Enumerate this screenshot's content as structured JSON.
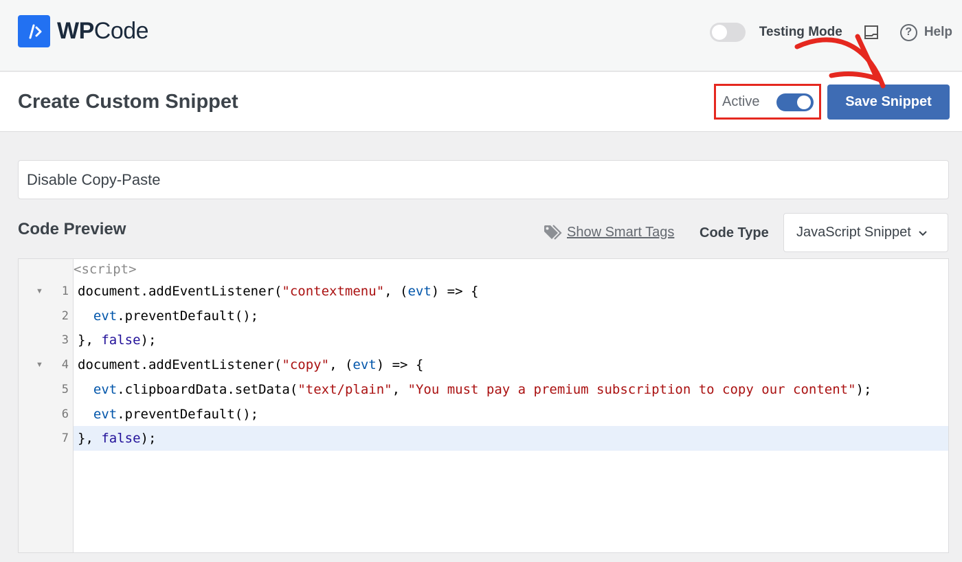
{
  "app": {
    "logo_bold": "WP",
    "logo_light": "Code"
  },
  "topbar": {
    "testing_mode_label": "Testing Mode",
    "testing_mode_on": false,
    "help_label": "Help",
    "icons": {
      "logo": "code-brackets-icon",
      "docs": "document-icon",
      "help": "question-circle-icon"
    }
  },
  "header": {
    "title": "Create Custom Snippet",
    "active_label": "Active",
    "active_on": true,
    "save_label": "Save Snippet",
    "accent_color": "#3e6cb4",
    "highlight_color": "#e5281f"
  },
  "snippet": {
    "title_value": "Disable Copy-Paste"
  },
  "code_preview": {
    "section_title": "Code Preview",
    "smart_tags_label": "Show Smart Tags",
    "code_type_label": "Code Type",
    "code_type_value": "JavaScript Snippet",
    "prefix": "<script>",
    "lines": [
      {
        "num": "1",
        "fold": true,
        "tokens": [
          [
            "plain",
            "document.addEventListener("
          ],
          [
            "str",
            "\"contextmenu\""
          ],
          [
            "plain",
            ", ("
          ],
          [
            "var",
            "evt"
          ],
          [
            "plain",
            ") => {"
          ]
        ]
      },
      {
        "num": "2",
        "fold": false,
        "tokens": [
          [
            "plain",
            "  "
          ],
          [
            "var",
            "evt"
          ],
          [
            "plain",
            ".preventDefault();"
          ]
        ]
      },
      {
        "num": "3",
        "fold": false,
        "tokens": [
          [
            "plain",
            "}, "
          ],
          [
            "kw",
            "false"
          ],
          [
            "plain",
            ");"
          ]
        ]
      },
      {
        "num": "4",
        "fold": true,
        "tokens": [
          [
            "plain",
            "document.addEventListener("
          ],
          [
            "str",
            "\"copy\""
          ],
          [
            "plain",
            ", ("
          ],
          [
            "var",
            "evt"
          ],
          [
            "plain",
            ") => {"
          ]
        ]
      },
      {
        "num": "5",
        "fold": false,
        "tokens": [
          [
            "plain",
            "  "
          ],
          [
            "var",
            "evt"
          ],
          [
            "plain",
            ".clipboardData.setData("
          ],
          [
            "str",
            "\"text/plain\""
          ],
          [
            "plain",
            ", "
          ],
          [
            "str",
            "\"You must pay a premium subscription to copy our content\""
          ],
          [
            "plain",
            ");"
          ]
        ]
      },
      {
        "num": "6",
        "fold": false,
        "tokens": [
          [
            "plain",
            "  "
          ],
          [
            "var",
            "evt"
          ],
          [
            "plain",
            ".preventDefault();"
          ]
        ]
      },
      {
        "num": "7",
        "fold": false,
        "highlighted": true,
        "tokens": [
          [
            "plain",
            "}, "
          ],
          [
            "kw",
            "false"
          ],
          [
            "plain",
            ");"
          ]
        ]
      }
    ]
  }
}
